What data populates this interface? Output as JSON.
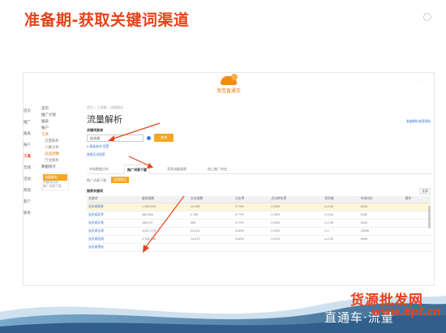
{
  "slide": {
    "title": "准备期-获取关键词渠道"
  },
  "app": {
    "logo_text": "淘宝直通车",
    "top_right": "· · · · · ·",
    "breadcrumb": "首页 > 工具箱 > 流量解析",
    "page_title": "流量解析",
    "help_link": "流量解析使用帮助"
  },
  "sidebar": {
    "col1": [
      "首页",
      "推广",
      "报表",
      "账户",
      "工具",
      "无线",
      "活动",
      "帮助",
      "客户",
      "联系"
    ],
    "items": [
      {
        "label": "首页",
        "cls": ""
      },
      {
        "label": "推广计划",
        "cls": ""
      },
      {
        "label": "报表",
        "cls": ""
      },
      {
        "label": "账户",
        "cls": ""
      },
      {
        "label": "工具",
        "cls": "hl"
      },
      {
        "label": "流量解析",
        "cls": "sub"
      },
      {
        "label": "人群分析",
        "cls": "sub"
      },
      {
        "label": "竞品洞察",
        "cls": "sub hl"
      },
      {
        "label": "行业解析",
        "cls": "sub"
      },
      {
        "label": "数据统计",
        "cls": ""
      }
    ],
    "popup_active": "流量解析",
    "popup_items": [
      "关键词分析",
      "推广词表下载"
    ]
  },
  "search": {
    "label": "关键词查询",
    "value": "连衣裙",
    "button": "查询",
    "opt1": "● 高级查询 设置",
    "opt2": "查看历史搜索"
  },
  "tabs": [
    "市场数据分析",
    "推广词表下载",
    "竞争流量透视",
    "线上推广排名"
  ],
  "subfilter": {
    "label": "推广词表下载",
    "button": "全部类目"
  },
  "table": {
    "title": "推荐关键词",
    "select": "全部",
    "headers": [
      "关键词",
      "展现指数",
      "点击指数",
      "点击率",
      "点击转化率",
      "竞争度",
      "市场均价",
      "操作"
    ],
    "rows": [
      {
        "kw": "连衣裙新款",
        "c": [
          "1,285,404",
          "14,985",
          "0.74%",
          "0.30%",
          "4,4.54",
          "4425"
        ],
        "hl": true
      },
      {
        "kw": "连衣裙夏季",
        "c": [
          "485,365",
          "2,784",
          "0.77%",
          "0.36%",
          "4,3.64",
          "2252"
        ],
        "hl": false
      },
      {
        "kw": "连衣裙女装",
        "c": [
          "165,197",
          "956",
          "0.72%",
          "0.40%",
          "4,1.95",
          "1164"
        ],
        "hl": false
      },
      {
        "kw": "连衣裙长裙",
        "c": [
          "4,021,778",
          "23,421",
          "0.60%",
          "0.30%",
          "4.1",
          "23096"
        ],
        "hl": false
      },
      {
        "kw": "连衣裙短裙",
        "c": [
          "1,766,136",
          "14,871",
          "0.80%",
          "0.41%",
          "4,2.32",
          "9008"
        ],
        "hl": false
      },
      {
        "kw": "连衣裙雪纺",
        "c": [
          "",
          "",
          "",
          "",
          "",
          ""
        ],
        "hl": false
      }
    ]
  },
  "footer": {
    "brand": "直通车·流量",
    "watermark": "货源批发网",
    "watermark_url": "www.6pf.cn"
  },
  "colors": {
    "title": "#e8421a",
    "accent": "#f5a623",
    "link": "#3a7bd5",
    "band": "#2f5f8a"
  }
}
